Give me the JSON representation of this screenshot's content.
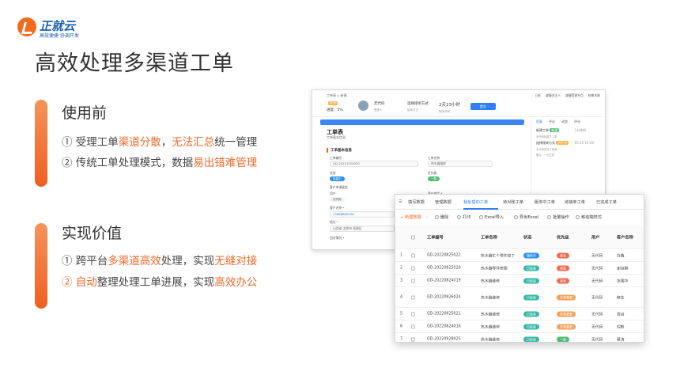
{
  "logo": {
    "name": "正就云",
    "slogan": "高效便捷 协调开发",
    "brand_color": "#1a5fb4"
  },
  "main_title": "高效处理多渠道工单",
  "accent_color": "#ef6a2a",
  "before": {
    "title": "使用前",
    "line1": {
      "p1": "① 受理工单",
      "h1": "渠道分散",
      "p2": "，",
      "h2": "无法汇总",
      "p3": "统一管理"
    },
    "line2": {
      "p1": "② 传统工单处理模式，数据",
      "h1": "易出错难管理"
    }
  },
  "value": {
    "title": "实现价值",
    "line1": {
      "p1": "① 跨平台",
      "h1": "多渠道高效",
      "p2": "处理，实现",
      "h2": "无缝对接"
    },
    "line2": {
      "h0": "② 自动",
      "p1": "整理处理工单进展，实现",
      "h1": "高效办公"
    }
  },
  "back_screen": {
    "crumb": "工单表 ◇ 新建",
    "status_chip": "进行中",
    "progress": "进度：5%",
    "owner": {
      "value": "无代码",
      "label": "受理人"
    },
    "channel": {
      "value": "选择接单方式",
      "label": "接单方式"
    },
    "duration": {
      "value": "2天23小时",
      "label": "剩余时间"
    },
    "submit": "提交",
    "actions": [
      "已处",
      "减慢关注人",
      "减慢受理节点",
      "结束关联"
    ],
    "form_title": "工单表",
    "form_sub": "工单基本信息",
    "section": "工单基本信息",
    "labels": {
      "no": "工单编号",
      "name": "工单名称",
      "state": "状态",
      "priority": "优先级",
      "customer_info": "客户申请服务",
      "user": "用户",
      "customer_name": "客户名称 *",
      "phone": "客户电话 *",
      "address": "地址 *",
      "tail": "回访情况 *"
    },
    "values": {
      "no": "GD-20221024030",
      "name": "热水器维修",
      "state": "新建中",
      "priority": "一般",
      "user": "无代码",
      "phone": "13888882036",
      "address": "山西省 太原市 晋源区"
    },
    "right_tabs": [
      "回复",
      "评论",
      "动态",
      "评论"
    ],
    "logs": [
      {
        "title": "新建工单",
        "tag": "新建",
        "time": "1分钟前",
        "sub": "无代码新建了工单"
      },
      {
        "title": "选择接单方式",
        "tag": "进行中",
        "time": "05-26 15:00",
        "sub": "无代码完成了接单",
        "sub2": "备注：一切正常"
      }
    ]
  },
  "front_screen": {
    "tabs": [
      "填写数据",
      "管理数据",
      "我处理的工单",
      "待对账工单",
      "服务中工单",
      "待接单工单",
      "已完成工单"
    ],
    "active_tab": 2,
    "tools": {
      "new": "+ 新建数据",
      "delete": "删除",
      "print": "打印",
      "import": "Excel导入",
      "export": "导出Excel",
      "batch": "批量操作",
      "mobile": "移动端样式"
    },
    "columns": [
      "工单编号",
      "工单名称",
      "状态",
      "优先级",
      "用户",
      "客户名称"
    ],
    "rows": [
      {
        "idx": "1",
        "no": "GD-20220825022",
        "name": "热水器忙个零件掉了",
        "state": "服务中",
        "priority": "紧急",
        "user": "无代码",
        "customer": "白鑫"
      },
      {
        "idx": "2",
        "no": "GD-20220825020",
        "name": "热水器零件修理",
        "state": "已结束",
        "priority": "紧急",
        "user": "无代码",
        "customer": "谢谷鹏"
      },
      {
        "idx": "3",
        "no": "GD-20220824019",
        "name": "热水器维修",
        "state": "已结束",
        "priority": "紧急",
        "user": "无代码",
        "customer": "张国华"
      },
      {
        "idx": "4",
        "no": "GD-20220926024",
        "name": "热水器维修",
        "state": "已结束",
        "priority": "非常重要",
        "user": "无代码",
        "customer": "麻生"
      },
      {
        "idx": "5",
        "no": "GD-20220825021",
        "name": "热水器维修",
        "state": "已结束",
        "priority": "非常重要",
        "user": "无代码",
        "customer": "宫谷"
      },
      {
        "idx": "6",
        "no": "GD-20220824016",
        "name": "热水器维修",
        "state": "已结束",
        "priority": "非常重要",
        "user": "无代码",
        "customer": "倪敖"
      },
      {
        "idx": "7",
        "no": "GD-20220928025",
        "name": "热水器维修",
        "state": "已结束",
        "priority": "一般",
        "user": "无代码",
        "customer": "蔡涛"
      }
    ],
    "colors": {
      "serving": "#2f8ff2",
      "done": "#37b9a6",
      "urgent": "#ef6a50",
      "important": "#f3a15b",
      "normal": "#52bb7a"
    }
  }
}
